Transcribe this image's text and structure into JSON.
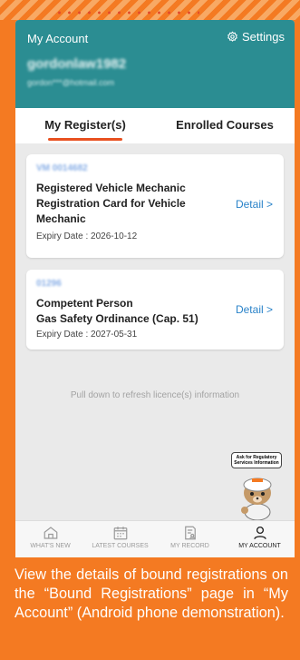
{
  "header": {
    "title": "My Account",
    "settings_label": "Settings",
    "username": "gordonlaw1982",
    "email": "gordon***@hotmail.com"
  },
  "tabs": [
    {
      "label": "My Register(s)",
      "active": true
    },
    {
      "label": "Enrolled Courses",
      "active": false
    }
  ],
  "cards": [
    {
      "reg_no": "VM 0014682",
      "name_lines": [
        "Registered Vehicle Mechanic",
        "Registration Card for Vehicle",
        "Mechanic"
      ],
      "expiry": "Expiry Date : 2026-10-12",
      "detail_label": "Detail >"
    },
    {
      "reg_no": "01296",
      "name_lines": [
        "Competent Person",
        "Gas Safety Ordinance (Cap. 51)"
      ],
      "expiry": "Expiry Date : 2027-05-31",
      "detail_label": "Detail >"
    }
  ],
  "refresh_hint": "Pull down to refresh licence(s) information",
  "assistant": {
    "bubble_line1": "Ask for Regulatory",
    "bubble_line2": "Services Information"
  },
  "bottom_nav": [
    {
      "label": "WHAT'S NEW",
      "icon": "home-icon",
      "active": false
    },
    {
      "label": "LATEST COURSES",
      "icon": "calendar-icon",
      "active": false
    },
    {
      "label": "MY RECORD",
      "icon": "record-icon",
      "active": false
    },
    {
      "label": "MY ACCOUNT",
      "icon": "account-icon",
      "active": true
    }
  ],
  "caption": "View the details of bound registrations on the “Bound Registrations” page in “My Account” (Android phone demonstration).",
  "colors": {
    "background": "#f47a22",
    "header": "#2b8d92",
    "tab_indicator": "#e8501f",
    "link": "#2a83c9"
  }
}
